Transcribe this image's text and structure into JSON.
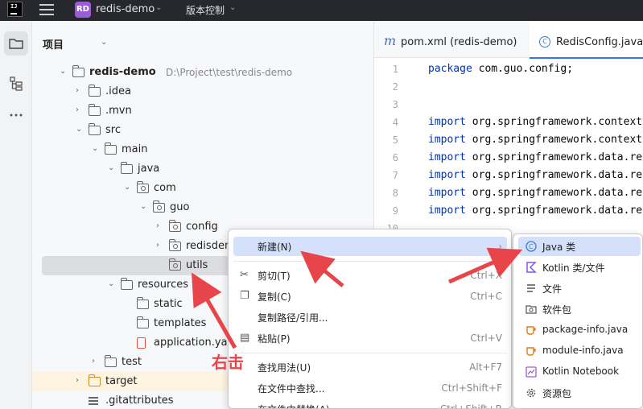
{
  "titlebar": {
    "project_badge": "RD",
    "project_name": "redis-demo",
    "vcs_label": "版本控制"
  },
  "panel": {
    "title": "项目"
  },
  "tree": [
    {
      "label": "redis-demo",
      "path": "D:\\Project\\test\\redis-demo",
      "bold": true
    },
    {
      "label": ".idea"
    },
    {
      "label": ".mvn"
    },
    {
      "label": "src"
    },
    {
      "label": "main"
    },
    {
      "label": "java"
    },
    {
      "label": "com"
    },
    {
      "label": "guo"
    },
    {
      "label": "config"
    },
    {
      "label": "redisdemo"
    },
    {
      "label": "utils",
      "selected": true
    },
    {
      "label": "resources"
    },
    {
      "label": "static"
    },
    {
      "label": "templates"
    },
    {
      "label": "application.yaml"
    },
    {
      "label": "test"
    },
    {
      "label": "target",
      "highlight": true
    },
    {
      "label": ".gitattributes"
    }
  ],
  "tabs": [
    {
      "label": "pom.xml (redis-demo)"
    },
    {
      "label": "RedisConfig.java",
      "active": true
    }
  ],
  "code": [
    {
      "num": "1",
      "kw": "package",
      "rest": " com.guo.config;"
    },
    {
      "num": "2",
      "kw": "",
      "rest": ""
    },
    {
      "num": "3",
      "kw": "",
      "rest": ""
    },
    {
      "num": "4",
      "kw": "import",
      "rest": " org.springframework.context"
    },
    {
      "num": "5",
      "kw": "import",
      "rest": " org.springframework.context"
    },
    {
      "num": "6",
      "kw": "import",
      "rest": " org.springframework.data.re"
    },
    {
      "num": "7",
      "kw": "import",
      "rest": " org.springframework.data.re"
    },
    {
      "num": "8",
      "kw": "import",
      "rest": " org.springframework.data.re"
    },
    {
      "num": "9",
      "kw": "import",
      "rest": " org.springframework.data.re"
    },
    {
      "num": "10",
      "kw": "",
      "rest": ""
    }
  ],
  "context_menu": [
    {
      "label": "新建(N)",
      "shortcut": "",
      "submenu": true,
      "hover": true
    },
    {
      "label": "剪切(T)",
      "shortcut": "Ctrl+X",
      "icon": "scissors-icon"
    },
    {
      "label": "复制(C)",
      "shortcut": "Ctrl+C",
      "icon": "copy-icon"
    },
    {
      "label": "复制路径/引用...",
      "shortcut": ""
    },
    {
      "label": "粘贴(P)",
      "shortcut": "Ctrl+V",
      "icon": "paste-icon"
    },
    {
      "label": "查找用法(U)",
      "shortcut": "Alt+F7"
    },
    {
      "label": "在文件中查找...",
      "shortcut": "Ctrl+Shift+F"
    },
    {
      "label": "在文件中替换(A)...",
      "shortcut": "Ctrl+Shift+R"
    }
  ],
  "submenu": [
    {
      "label": "Java 类",
      "icon": "java-class-icon",
      "hover": true
    },
    {
      "label": "Kotlin 类/文件",
      "icon": "kotlin-icon"
    },
    {
      "label": "文件",
      "icon": "file-lines-icon"
    },
    {
      "label": "软件包",
      "icon": "package-icon"
    },
    {
      "label": "package-info.java",
      "icon": "java-cup-icon"
    },
    {
      "label": "module-info.java",
      "icon": "java-cup-icon"
    },
    {
      "label": "Kotlin Notebook",
      "icon": "notebook-icon"
    },
    {
      "label": "资源包",
      "icon": "gear-icon"
    }
  ],
  "annotation": {
    "label": "右击",
    "color": "#e8454a"
  },
  "colors": {
    "accent": "#3574f0",
    "selection": "#dcdde1",
    "menu_hover": "#d5e1fb"
  }
}
